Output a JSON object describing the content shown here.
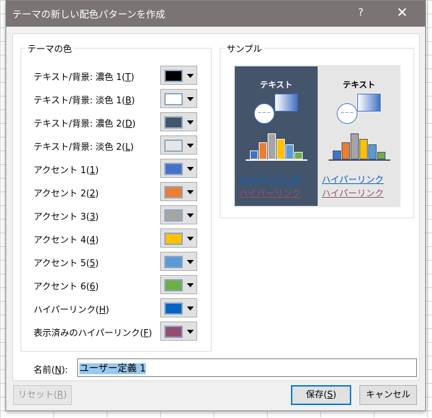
{
  "title": "テーマの新しい配色パターンを作成",
  "help": "?",
  "close": "✕",
  "theme_group": "テーマの色",
  "sample_group": "サンプル",
  "rows": [
    {
      "pre": "テキスト/背景: 濃色 1(",
      "key": "T",
      "post": ")",
      "color": "#000000"
    },
    {
      "pre": "テキスト/背景: 淡色 1(",
      "key": "B",
      "post": ")",
      "color": "#ffffff"
    },
    {
      "pre": "テキスト/背景: 濃色 2(",
      "key": "D",
      "post": ")",
      "color": "#44546a"
    },
    {
      "pre": "テキスト/背景: 淡色 2(",
      "key": "L",
      "post": ")",
      "color": "#e7e6e6"
    },
    {
      "pre": "アクセント 1(",
      "key": "1",
      "post": ")",
      "color": "#4472c4"
    },
    {
      "pre": "アクセント 2(",
      "key": "2",
      "post": ")",
      "color": "#ed7d31"
    },
    {
      "pre": "アクセント 3(",
      "key": "3",
      "post": ")",
      "color": "#a5a5a5"
    },
    {
      "pre": "アクセント 4(",
      "key": "4",
      "post": ")",
      "color": "#ffc000"
    },
    {
      "pre": "アクセント 5(",
      "key": "5",
      "post": ")",
      "color": "#5b9bd5"
    },
    {
      "pre": "アクセント 6(",
      "key": "6",
      "post": ")",
      "color": "#70ad47"
    },
    {
      "pre": "ハイパーリンク(",
      "key": "H",
      "post": ")",
      "color": "#0563c1"
    },
    {
      "pre": "表示済みのハイパーリンク(",
      "key": "F",
      "post": ")",
      "color": "#954f72"
    }
  ],
  "sample": {
    "text": "テキスト",
    "hyperlink": "ハイパーリンク",
    "visited": "ハイパーリンク",
    "shape_text": "~~~"
  },
  "name": {
    "pre": "名前(",
    "key": "N",
    "post": "):",
    "value": "ユーザー定義 1"
  },
  "buttons": {
    "reset_pre": "リセット(",
    "reset_key": "R",
    "reset_post": ")",
    "save_pre": "保存(",
    "save_key": "S",
    "save_post": ")",
    "cancel": "キャンセル"
  }
}
